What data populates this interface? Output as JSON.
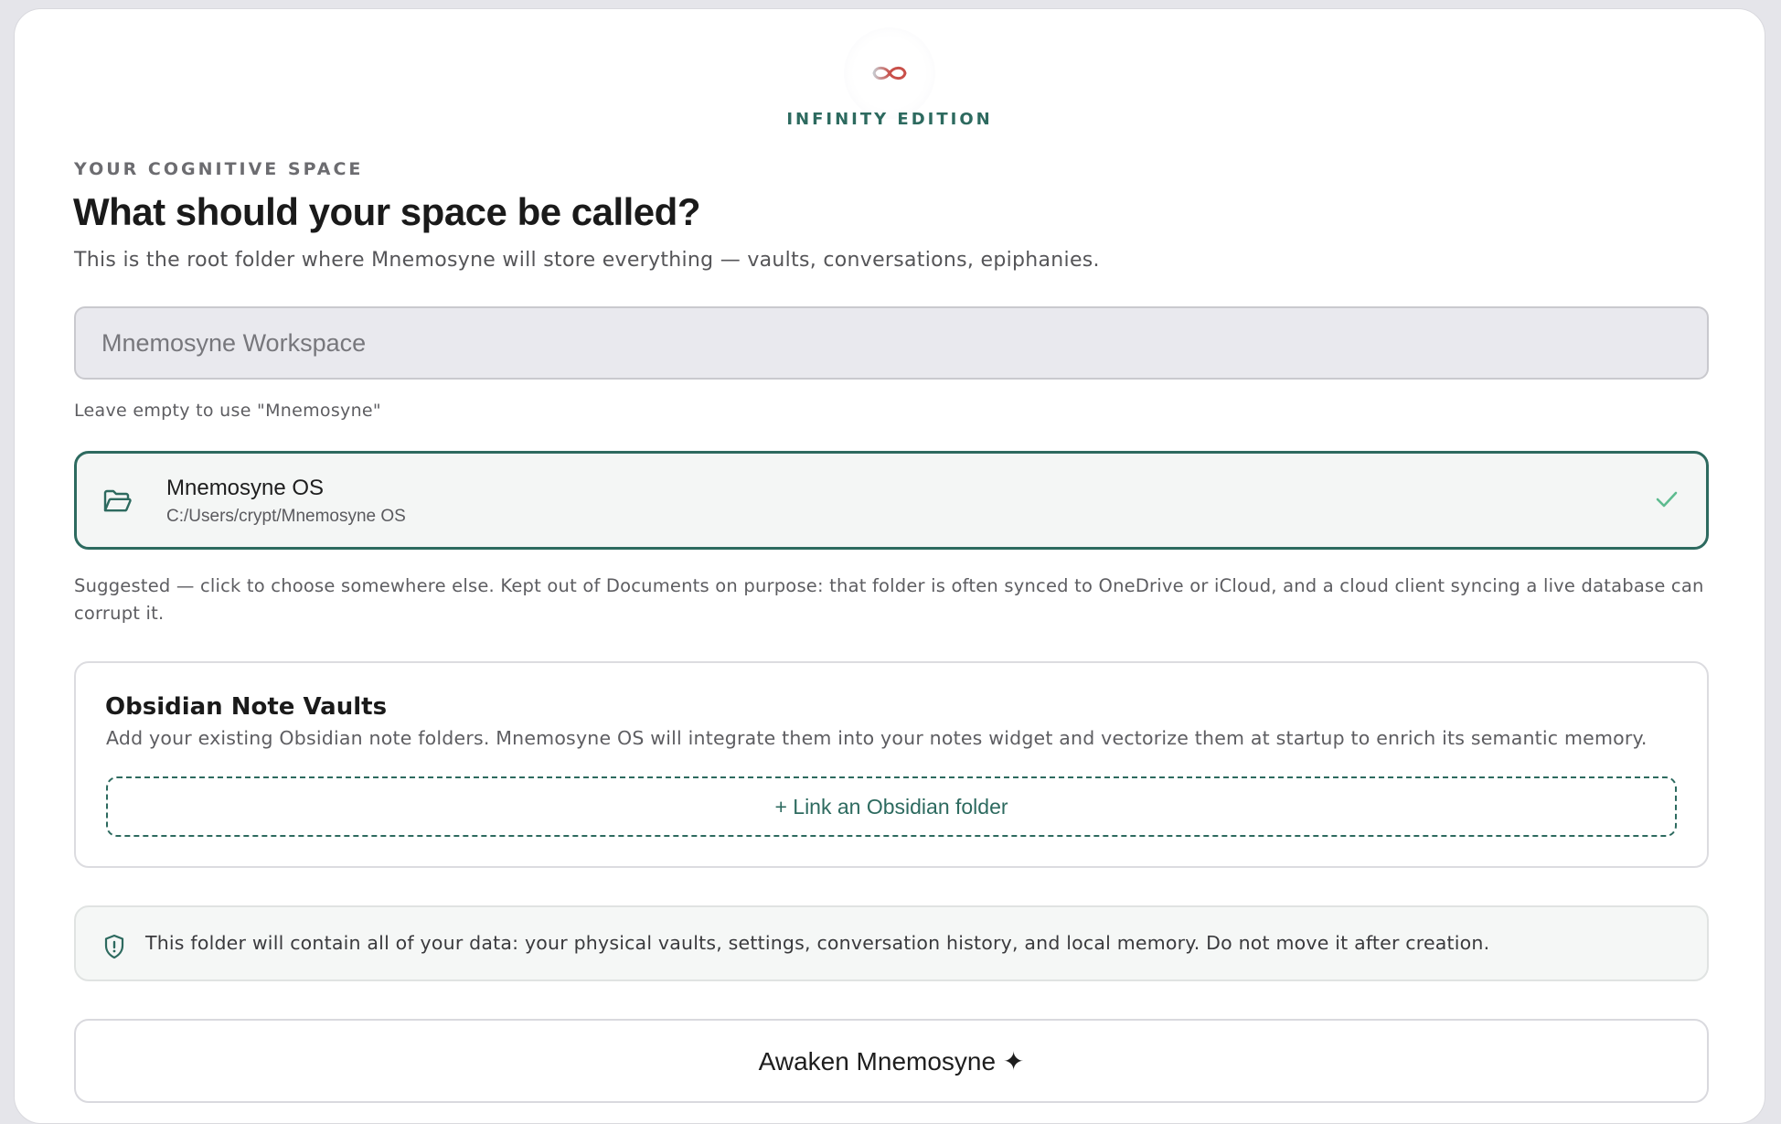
{
  "header": {
    "logo_icon": "infinity-icon",
    "edition_label": "INFINITY EDITION"
  },
  "intro": {
    "eyebrow": "YOUR COGNITIVE SPACE",
    "title": "What should your space be called?",
    "subtitle": "This is the root folder where Mnemosyne will store everything — vaults, conversations, epiphanies."
  },
  "name_field": {
    "value": "",
    "placeholder": "Mnemosyne Workspace",
    "hint": "Leave empty to use \"Mnemosyne\""
  },
  "folder": {
    "icon": "folder-open-icon",
    "name": "Mnemosyne OS",
    "path": "C:/Users/crypt/Mnemosyne OS",
    "selected_icon": "check-icon",
    "note": "Suggested — click to choose somewhere else. Kept out of Documents on purpose: that folder is often synced to OneDrive or iCloud, and a cloud client syncing a live database can corrupt it."
  },
  "obsidian": {
    "title": "Obsidian Note Vaults",
    "description": "Add your existing Obsidian note folders. Mnemosyne OS will integrate them into your notes widget and vectorize them at startup to enrich its semantic memory.",
    "link_button": "+ Link an Obsidian folder"
  },
  "notice": {
    "icon": "shield-icon",
    "text": "This folder will contain all of your data: your physical vaults, settings, conversation history, and local memory. Do not move it after creation."
  },
  "submit": {
    "label": "Awaken Mnemosyne ✦"
  },
  "colors": {
    "accent": "#2d6a5f",
    "logo_red": "#c9504a",
    "check_green": "#5dbb8f"
  }
}
